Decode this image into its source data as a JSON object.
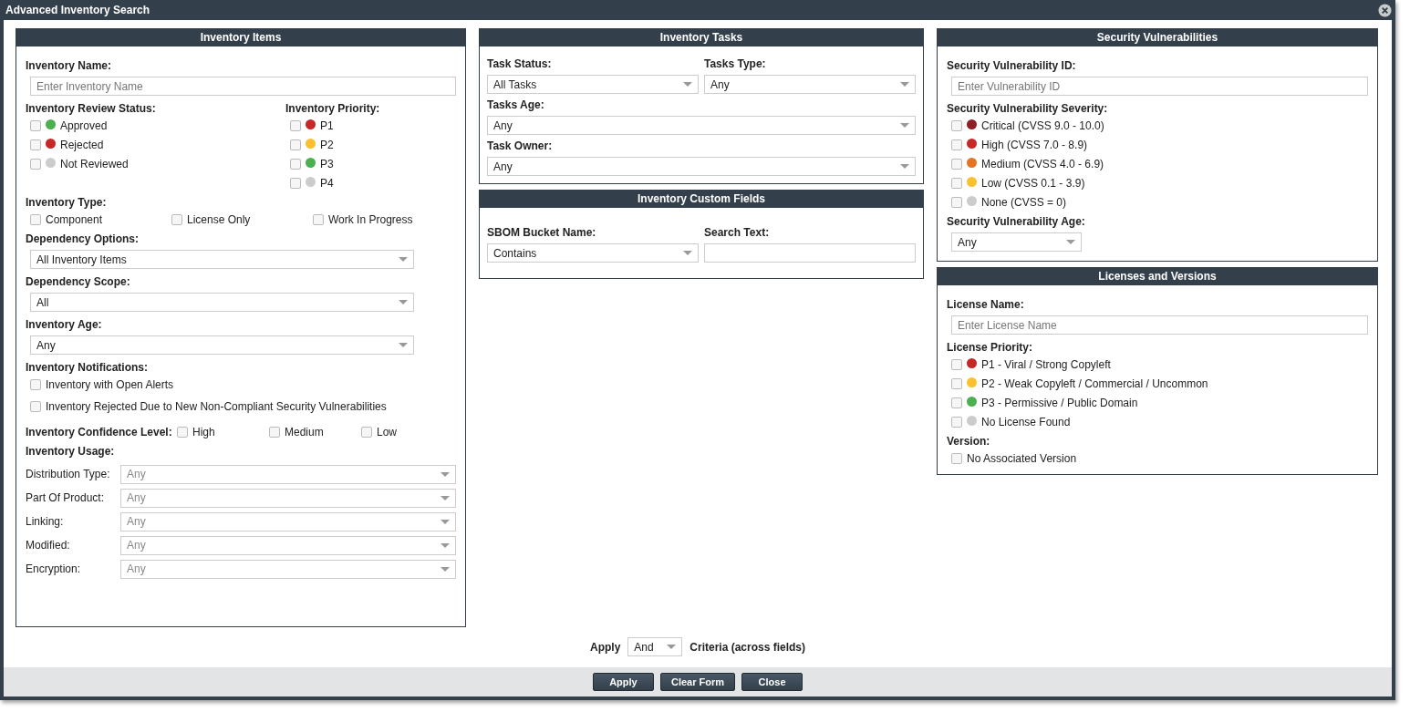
{
  "window": {
    "title": "Advanced Inventory Search"
  },
  "inventory_items": {
    "title": "Inventory Items",
    "name": {
      "label": "Inventory Name:",
      "placeholder": "Enter Inventory Name"
    },
    "review_status": {
      "label": "Inventory Review Status:",
      "options": [
        {
          "label": "Approved",
          "color": "#4caf50",
          "checked": false
        },
        {
          "label": "Rejected",
          "color": "#c62828",
          "checked": false
        },
        {
          "label": "Not Reviewed",
          "color": "#cccccc",
          "checked": false
        }
      ]
    },
    "priority": {
      "label": "Inventory Priority:",
      "options": [
        {
          "label": "P1",
          "color": "#c62828",
          "checked": false
        },
        {
          "label": "P2",
          "color": "#fbc02d",
          "checked": false
        },
        {
          "label": "P3",
          "color": "#4caf50",
          "checked": false
        },
        {
          "label": "P4",
          "color": "#cccccc",
          "checked": false
        }
      ]
    },
    "type": {
      "label": "Inventory Type:",
      "options": [
        {
          "label": "Component",
          "checked": false
        },
        {
          "label": "License Only",
          "checked": false
        },
        {
          "label": "Work In Progress",
          "checked": false
        }
      ]
    },
    "selects": [
      {
        "label": "Dependency Options:",
        "value": "All Inventory Items"
      },
      {
        "label": "Dependency Scope:",
        "value": "All"
      },
      {
        "label": "Inventory Age:",
        "value": "Any"
      }
    ],
    "notifications": {
      "label": "Inventory Notifications:",
      "options": [
        {
          "label": "Inventory with Open Alerts",
          "checked": false
        },
        {
          "label": "Inventory Rejected Due to New Non-Compliant Security Vulnerabilities",
          "checked": false
        }
      ]
    },
    "confidence": {
      "label": "Inventory Confidence Level:",
      "options": [
        {
          "label": "High",
          "checked": false
        },
        {
          "label": "Medium",
          "checked": false
        },
        {
          "label": "Low",
          "checked": false
        }
      ]
    },
    "usage": {
      "label": "Inventory Usage:",
      "fields": [
        {
          "label": "Distribution Type:",
          "value": "Any",
          "disabled": true
        },
        {
          "label": "Part Of Product:",
          "value": "Any",
          "disabled": true
        },
        {
          "label": "Linking:",
          "value": "Any",
          "disabled": true
        },
        {
          "label": "Modified:",
          "value": "Any",
          "disabled": true
        },
        {
          "label": "Encryption:",
          "value": "Any",
          "disabled": true
        }
      ]
    }
  },
  "inventory_tasks": {
    "title": "Inventory Tasks",
    "rows": [
      [
        {
          "label": "Task Status:",
          "value": "All Tasks"
        },
        {
          "label": "Tasks Type:",
          "value": "Any"
        }
      ],
      [
        {
          "label": "Tasks Age:",
          "value": "Any"
        }
      ],
      [
        {
          "label": "Task Owner:",
          "value": "Any"
        }
      ]
    ]
  },
  "custom_fields": {
    "title": "Inventory Custom Fields",
    "bucket": {
      "label": "SBOM Bucket Name:",
      "value": "Contains"
    },
    "search_text": {
      "label": "Search Text:"
    }
  },
  "security": {
    "title": "Security Vulnerabilities",
    "id": {
      "label": "Security Vulnerability ID:",
      "placeholder": "Enter Vulnerability ID"
    },
    "severity": {
      "label": "Security Vulnerability Severity:",
      "options": [
        {
          "label": "Critical (CVSS 9.0 - 10.0)",
          "color": "#8e1f26",
          "checked": false
        },
        {
          "label": "High (CVSS 7.0 - 8.9)",
          "color": "#c62828",
          "checked": false
        },
        {
          "label": "Medium (CVSS 4.0 - 6.9)",
          "color": "#e67322",
          "checked": false
        },
        {
          "label": "Low (CVSS 0.1 - 3.9)",
          "color": "#fbc02d",
          "checked": false
        },
        {
          "label": "None (CVSS = 0)",
          "color": "#cccccc",
          "checked": false
        }
      ]
    },
    "age": {
      "label": "Security Vulnerability Age:",
      "value": "Any"
    }
  },
  "licenses": {
    "title": "Licenses and Versions",
    "name": {
      "label": "License Name:",
      "placeholder": "Enter License Name"
    },
    "priority": {
      "label": "License Priority:",
      "options": [
        {
          "label": "P1 - Viral / Strong Copyleft",
          "color": "#c62828",
          "checked": false
        },
        {
          "label": "P2 - Weak Copyleft / Commercial / Uncommon",
          "color": "#fbc02d",
          "checked": false
        },
        {
          "label": "P3 - Permissive / Public Domain",
          "color": "#4caf50",
          "checked": false
        },
        {
          "label": "No License Found",
          "color": "#cccccc",
          "checked": false
        }
      ]
    },
    "version": {
      "label": "Version:",
      "options": [
        {
          "label": "No Associated Version",
          "checked": false
        }
      ]
    }
  },
  "criteria": {
    "prefix": "Apply",
    "value": "And",
    "suffix": "Criteria (across fields)"
  },
  "buttons": [
    "Apply",
    "Clear Form",
    "Close"
  ]
}
